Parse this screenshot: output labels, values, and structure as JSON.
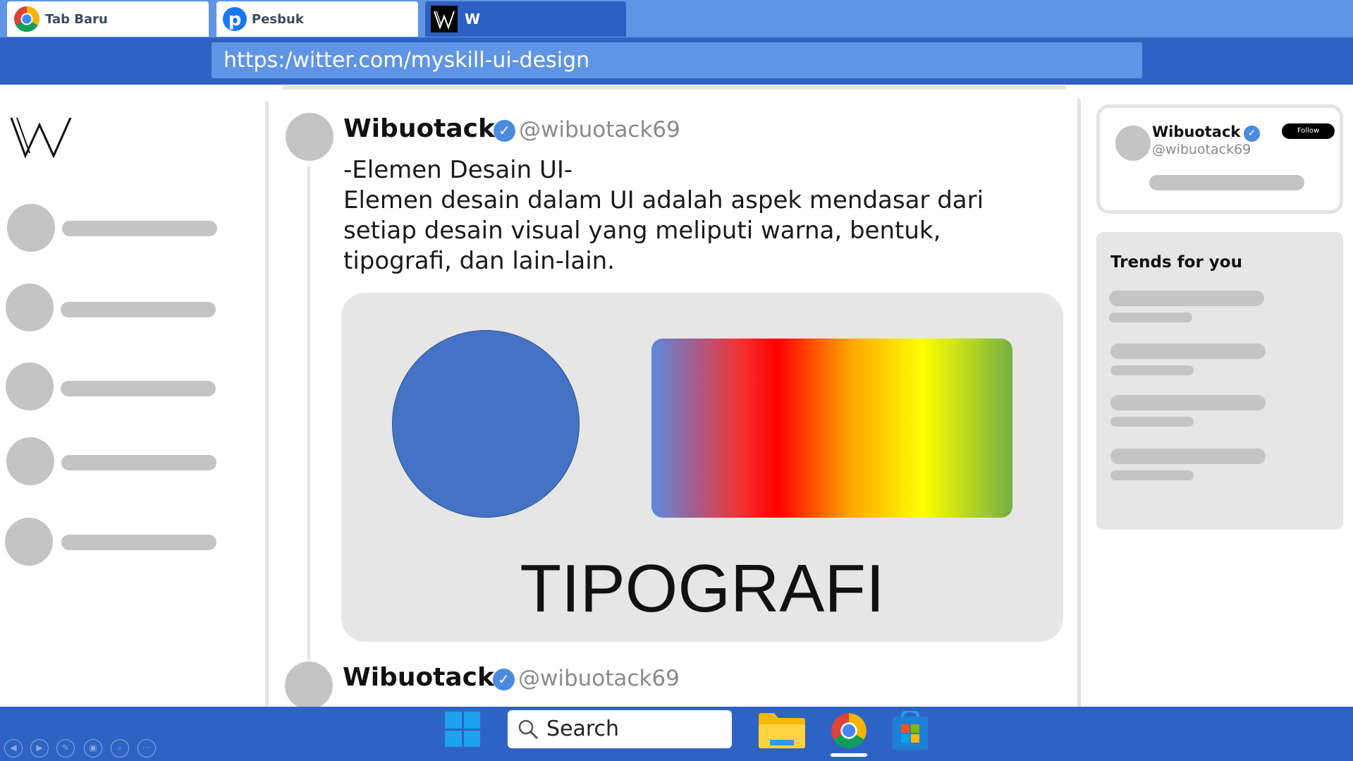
{
  "browser": {
    "tabs": [
      {
        "label": "Tab Baru",
        "icon": "chrome-icon",
        "active": false
      },
      {
        "label": "Pesbuk",
        "icon": "pesbuk-icon",
        "active": false
      },
      {
        "label": "W",
        "icon": "w-logo-icon",
        "active": true
      }
    ],
    "url": "https:/witter.com/myskill-ui-design"
  },
  "sidebar": {
    "logo": "w-logo-icon",
    "items": [
      {},
      {},
      {},
      {},
      {}
    ]
  },
  "posts": [
    {
      "author": "Wibuotack",
      "handle": "@wibuotack69",
      "text_lines": [
        "-Elemen Desain UI-",
        "Elemen desain dalam UI adalah aspek mendasar dari",
        "setiap desain visual yang meliputi warna, bentuk,",
        "tipografi, dan lain-lain."
      ],
      "media_word": "TIPOGRAFI"
    },
    {
      "author": "Wibuotack",
      "handle": "@wibuotack69"
    }
  ],
  "who_to_follow": {
    "name": "Wibuotack",
    "handle": "@wibuotack69",
    "follow_label": "Follow"
  },
  "trends": {
    "title": "Trends for you"
  },
  "taskbar": {
    "search_label": "Search",
    "apps": [
      "windows-start-icon",
      "file-explorer-icon",
      "chrome-icon",
      "microsoft-store-icon"
    ]
  },
  "colors": {
    "chrome_blue": "#2f63c3",
    "tab_blue": "#5f95e4",
    "verified_blue": "#4a8ae0",
    "placeholder_gray": "#c4c4c4",
    "shape_blue": "#4472c4"
  }
}
